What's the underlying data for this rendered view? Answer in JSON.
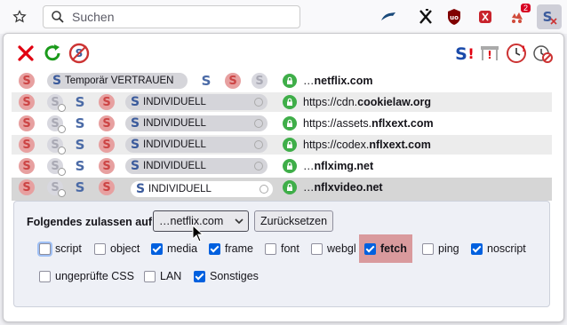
{
  "toolbar": {
    "search_placeholder": "Suchen",
    "ublock_badge": "2"
  },
  "sites": [
    {
      "control": "Temporär VERTRAUEN",
      "url_prefix": "…",
      "url_domain": "netflix.com"
    },
    {
      "control": "INDIVIDUELL",
      "url_prefix": "https://cdn.",
      "url_domain": "cookielaw.org"
    },
    {
      "control": "INDIVIDUELL",
      "url_prefix": "https://assets.",
      "url_domain": "nflxext.com"
    },
    {
      "control": "INDIVIDUELL",
      "url_prefix": "https://codex.",
      "url_domain": "nflxext.com"
    },
    {
      "control": "INDIVIDUELL",
      "url_prefix": "…",
      "url_domain": "nflximg.net"
    },
    {
      "control": "INDIVIDUELL",
      "url_prefix": "…",
      "url_domain": "nflxvideo.net"
    }
  ],
  "details": {
    "allow_label": "Folgendes zulassen auf",
    "domain_selected": "…netflix.com",
    "reset_label": "Zurücksetzen",
    "capabilities": [
      {
        "label": "script",
        "checked": false
      },
      {
        "label": "object",
        "checked": false
      },
      {
        "label": "media",
        "checked": true
      },
      {
        "label": "frame",
        "checked": true
      },
      {
        "label": "font",
        "checked": false
      },
      {
        "label": "webgl",
        "checked": false
      },
      {
        "label": "fetch",
        "checked": true
      },
      {
        "label": "ping",
        "checked": false
      },
      {
        "label": "noscript",
        "checked": true
      },
      {
        "label": "ungeprüfte CSS",
        "checked": false
      },
      {
        "label": "LAN",
        "checked": false
      },
      {
        "label": "Sonstiges",
        "checked": true
      }
    ]
  },
  "colors": {
    "highlight": "#d99a9d",
    "checkbox_on": "#0060df",
    "lock": "#3fae49"
  }
}
